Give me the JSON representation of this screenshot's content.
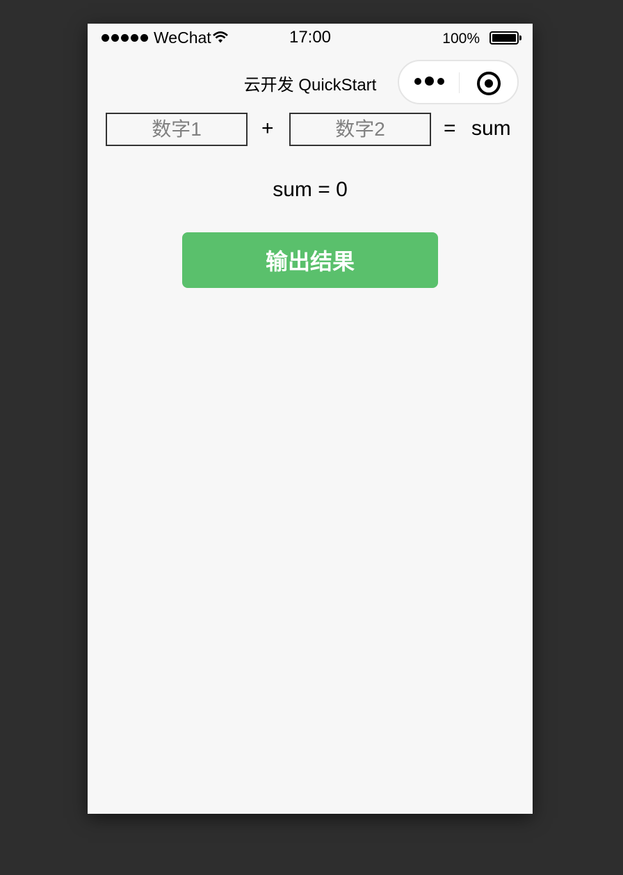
{
  "status_bar": {
    "carrier": "WeChat",
    "time": "17:00",
    "battery": "100%",
    "signal_icon": "signal-dots-icon",
    "wifi_icon": "wifi-icon",
    "battery_icon": "battery-full-icon"
  },
  "nav": {
    "title": "云开发 QuickStart",
    "more_icon": "more-dots-icon",
    "close_icon": "target-circle-icon"
  },
  "form": {
    "input1_placeholder": "数字1",
    "input2_placeholder": "数字2",
    "plus": "+",
    "equals": "=",
    "sum_label": "sum"
  },
  "result": {
    "prefix": "sum = ",
    "value": "0"
  },
  "button": {
    "label": "输出结果",
    "color": "#5ac06c"
  }
}
